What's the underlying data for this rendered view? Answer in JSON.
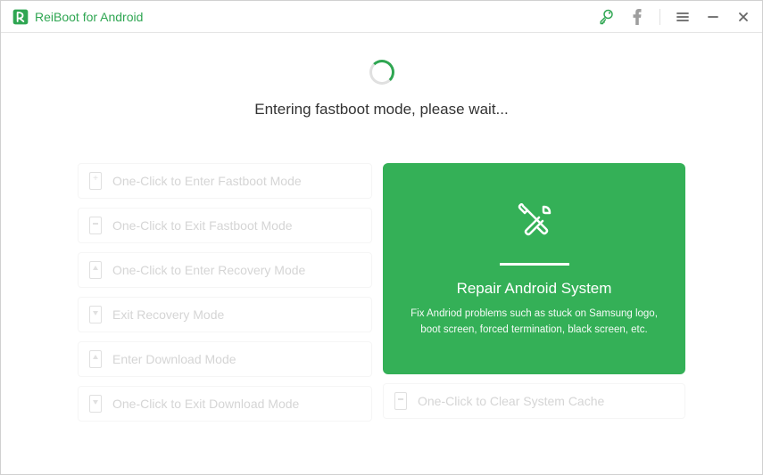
{
  "app": {
    "title": "ReiBoot for Android"
  },
  "status": {
    "message": "Entering fastboot mode, please wait..."
  },
  "modes": {
    "enter_fastboot": "One-Click to Enter Fastboot Mode",
    "exit_fastboot": "One-Click to Exit Fastboot Mode",
    "enter_recovery": "One-Click to Enter Recovery Mode",
    "exit_recovery": "Exit Recovery Mode",
    "enter_download": "Enter Download Mode",
    "exit_download": "One-Click to Exit Download Mode",
    "clear_cache": "One-Click to Clear System Cache"
  },
  "repair": {
    "title": "Repair Android System",
    "description": "Fix Andriod problems such as stuck on Samsung logo, boot screen, forced termination, black screen, etc."
  },
  "colors": {
    "accent": "#34b057",
    "brand": "#2fa652"
  }
}
